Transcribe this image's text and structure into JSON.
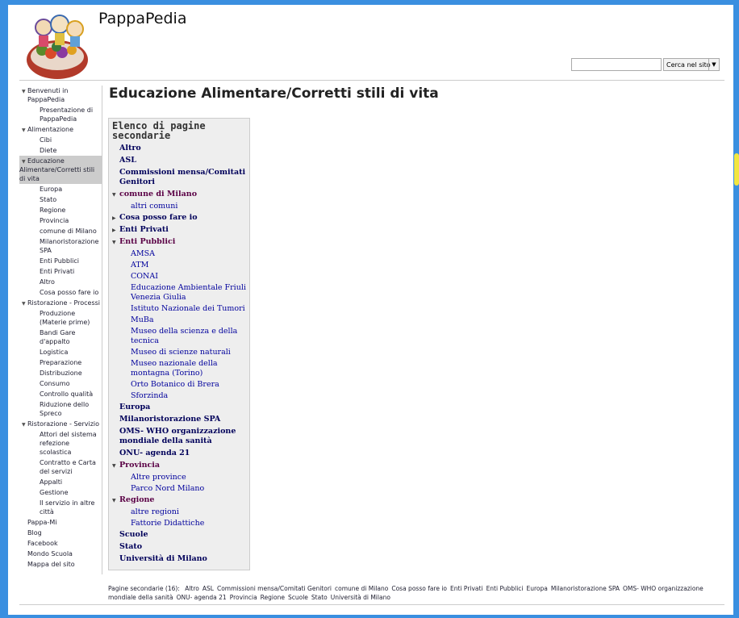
{
  "site": {
    "title": "PappaPedia"
  },
  "search": {
    "placeholder": "",
    "button_label": "Cerca nel sito"
  },
  "nav": {
    "items": [
      {
        "label": "Benvenuti in PappaPedia",
        "level": 1,
        "expanded": true
      },
      {
        "label": "Presentazione di PappaPedia",
        "level": 2
      },
      {
        "label": "Alimentazione",
        "level": 1,
        "expanded": true
      },
      {
        "label": "Cibi",
        "level": 2
      },
      {
        "label": "Diete",
        "level": 2
      },
      {
        "label": "Educazione Alimentare/Corretti stili di vita",
        "level": 1,
        "expanded": true,
        "selected": true
      },
      {
        "label": "Europa",
        "level": 2
      },
      {
        "label": "Stato",
        "level": 2
      },
      {
        "label": "Regione",
        "level": 2
      },
      {
        "label": "Provincia",
        "level": 2
      },
      {
        "label": "comune di Milano",
        "level": 2
      },
      {
        "label": "Milanoristorazione SPA",
        "level": 2
      },
      {
        "label": "Enti Pubblici",
        "level": 2
      },
      {
        "label": "Enti Privati",
        "level": 2
      },
      {
        "label": "Altro",
        "level": 2
      },
      {
        "label": "Cosa posso fare io",
        "level": 2
      },
      {
        "label": "Ristorazione - Processi",
        "level": 1,
        "expanded": true
      },
      {
        "label": "Produzione (Materie prime)",
        "level": 2
      },
      {
        "label": "Bandi Gare d'appalto",
        "level": 2
      },
      {
        "label": "Logistica",
        "level": 2
      },
      {
        "label": "Preparazione",
        "level": 2
      },
      {
        "label": "Distribuzione",
        "level": 2
      },
      {
        "label": "Consumo",
        "level": 2
      },
      {
        "label": "Controllo qualità",
        "level": 2
      },
      {
        "label": "Riduzione dello Spreco",
        "level": 2
      },
      {
        "label": "Ristorazione - Servizio",
        "level": 1,
        "expanded": true
      },
      {
        "label": "Attori del sistema refezione scolastica",
        "level": 2
      },
      {
        "label": "Contratto e Carta del servizi",
        "level": 2
      },
      {
        "label": "Appalti",
        "level": 2
      },
      {
        "label": "Gestione",
        "level": 2
      },
      {
        "label": "Il servizio in altre città",
        "level": 2
      },
      {
        "label": "Pappa-Mi",
        "level": 1
      },
      {
        "label": "Blog",
        "level": 1
      },
      {
        "label": "Facebook",
        "level": 1
      },
      {
        "label": "Mondo Scuola",
        "level": 1
      },
      {
        "label": "Mappa del sito",
        "level": 1
      }
    ]
  },
  "main": {
    "title": "Educazione Alimentare/Corretti stili di vita",
    "subpages_heading": "Elenco di pagine secondarie",
    "subpages": [
      {
        "label": "Altro",
        "level": 1
      },
      {
        "label": "ASL",
        "level": 1
      },
      {
        "label": "Commissioni mensa/Comitati Genitori",
        "level": 1
      },
      {
        "label": "comune di Milano",
        "level": 1,
        "toggle": "open"
      },
      {
        "label": "altri comuni",
        "level": 2
      },
      {
        "label": "Cosa posso fare io",
        "level": 1,
        "toggle": "closed"
      },
      {
        "label": "Enti Privati",
        "level": 1,
        "toggle": "closed"
      },
      {
        "label": "Enti Pubblici",
        "level": 1,
        "toggle": "open"
      },
      {
        "label": "AMSA",
        "level": 2
      },
      {
        "label": "ATM",
        "level": 2
      },
      {
        "label": "CONAI",
        "level": 2
      },
      {
        "label": "Educazione Ambientale Friuli Venezia Giulia",
        "level": 2
      },
      {
        "label": "Istituto Nazionale dei Tumori",
        "level": 2
      },
      {
        "label": "MuBa",
        "level": 2
      },
      {
        "label": "Museo della scienza e della tecnica",
        "level": 2
      },
      {
        "label": "Museo di scienze naturali",
        "level": 2
      },
      {
        "label": "Museo nazionale della montagna (Torino)",
        "level": 2
      },
      {
        "label": "Orto Botanico di Brera",
        "level": 2
      },
      {
        "label": "Sforzinda",
        "level": 2
      },
      {
        "label": "Europa",
        "level": 1
      },
      {
        "label": "Milanoristorazione SPA",
        "level": 1
      },
      {
        "label": "OMS- WHO organizzazione mondiale della sanità",
        "level": 1
      },
      {
        "label": "ONU- agenda 21",
        "level": 1
      },
      {
        "label": "Provincia",
        "level": 1,
        "toggle": "open"
      },
      {
        "label": "Altre province",
        "level": 2
      },
      {
        "label": "Parco Nord Milano",
        "level": 2
      },
      {
        "label": "Regione",
        "level": 1,
        "toggle": "open"
      },
      {
        "label": "altre regioni",
        "level": 2
      },
      {
        "label": "Fattorie Didattiche",
        "level": 2
      },
      {
        "label": "Scuole",
        "level": 1
      },
      {
        "label": "Stato",
        "level": 1
      },
      {
        "label": "Università di Milano",
        "level": 1
      }
    ],
    "footer_prefix": "Pagine secondarie (16):",
    "footer_links": [
      "Altro",
      "ASL",
      "Commissioni mensa/Comitati Genitori",
      "comune di Milano",
      "Cosa posso fare io",
      "Enti Privati",
      "Enti Pubblici",
      "Europa",
      "Milanoristorazione SPA",
      "OMS- WHO organizzazione mondiale della sanità",
      "ONU- agenda 21",
      "Provincia",
      "Regione",
      "Scuole",
      "Stato",
      "Università di Milano"
    ]
  }
}
